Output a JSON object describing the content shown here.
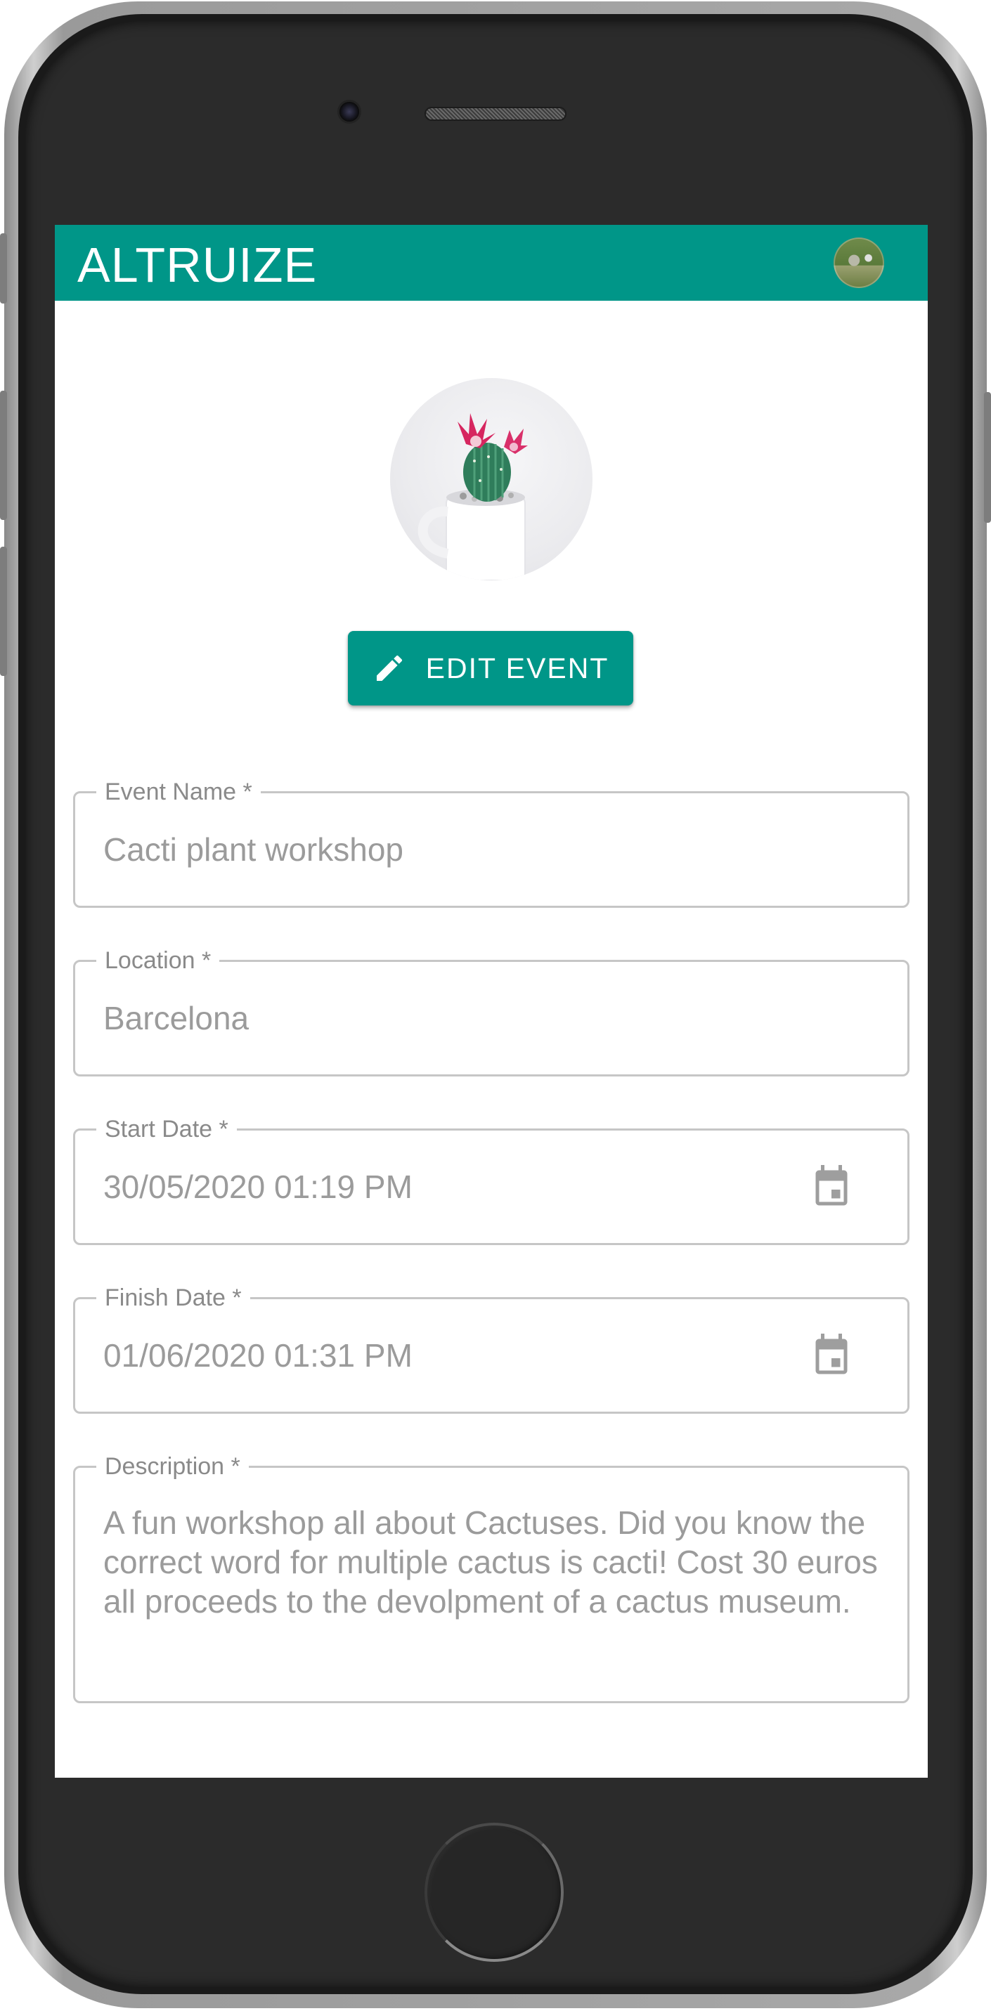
{
  "app": {
    "title": "ALTRUIZE"
  },
  "header": {
    "avatar_icon": "user-avatar-icon"
  },
  "event": {
    "image_icon": "cactus-photo",
    "edit_button": {
      "label": "EDIT EVENT",
      "icon": "pencil-icon"
    }
  },
  "form": {
    "event_name": {
      "label": "Event Name *",
      "value": "Cacti plant workshop"
    },
    "location": {
      "label": "Location *",
      "value": "Barcelona"
    },
    "start_date": {
      "label": "Start Date *",
      "value": "30/05/2020 01:19 PM",
      "icon": "calendar-icon"
    },
    "finish_date": {
      "label": "Finish Date *",
      "value": "01/06/2020 01:31 PM",
      "icon": "calendar-icon"
    },
    "description": {
      "label": "Description *",
      "value": "A fun workshop all about Cactuses. Did you know the correct word for multiple cactus is cacti! Cost 30 euros all proceeds to the devolpment of a cactus museum."
    }
  },
  "colors": {
    "primary": "#009688",
    "field_border": "#c6c6c6",
    "field_text": "#9b9b9b"
  }
}
